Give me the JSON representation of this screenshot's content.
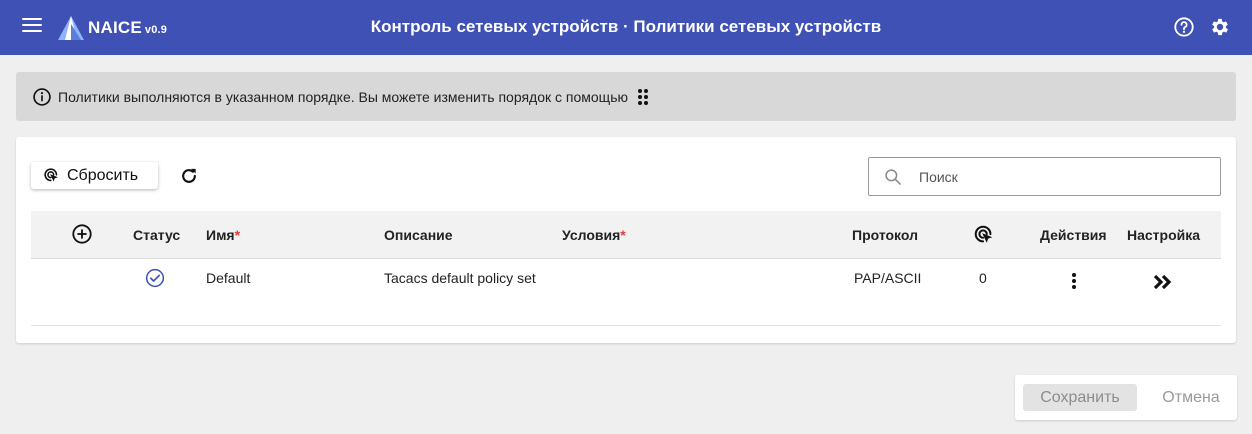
{
  "header": {
    "brand": "NAICE",
    "version": "v0.9",
    "title": "Контроль сетевых устройств · Политики сетевых устройств",
    "color": "#3f51b5"
  },
  "info_banner": {
    "text": "Политики выполняются в указанном порядке. Вы можете изменить порядок с помощью"
  },
  "toolbar": {
    "reset_label": "Сбросить",
    "search_placeholder": "Поиск"
  },
  "table": {
    "columns": {
      "status": "Статус",
      "name": "Имя",
      "description": "Описание",
      "conditions": "Условия",
      "protocol": "Протокол",
      "actions": "Действия",
      "settings": "Настройка"
    },
    "required_mark": "*",
    "rows": [
      {
        "status": "enabled",
        "name": "Default",
        "description": "Tacacs default policy set",
        "conditions": "",
        "protocol": "PAP/ASCII",
        "hits": "0"
      }
    ]
  },
  "footer": {
    "save_label": "Сохранить",
    "cancel_label": "Отмена"
  },
  "icons": {
    "menu": "menu-icon",
    "logo": "naice-logo",
    "help": "help-icon",
    "settings": "gear-icon",
    "info": "info-icon",
    "drag": "drag-handle-icon",
    "reset": "reset-cursor-icon",
    "refresh": "refresh-icon",
    "search": "search-icon",
    "add": "add-circle-icon",
    "hits": "hits-cursor-icon",
    "status": "check-circle-icon",
    "more": "kebab-icon",
    "open": "double-chevron-icon"
  }
}
